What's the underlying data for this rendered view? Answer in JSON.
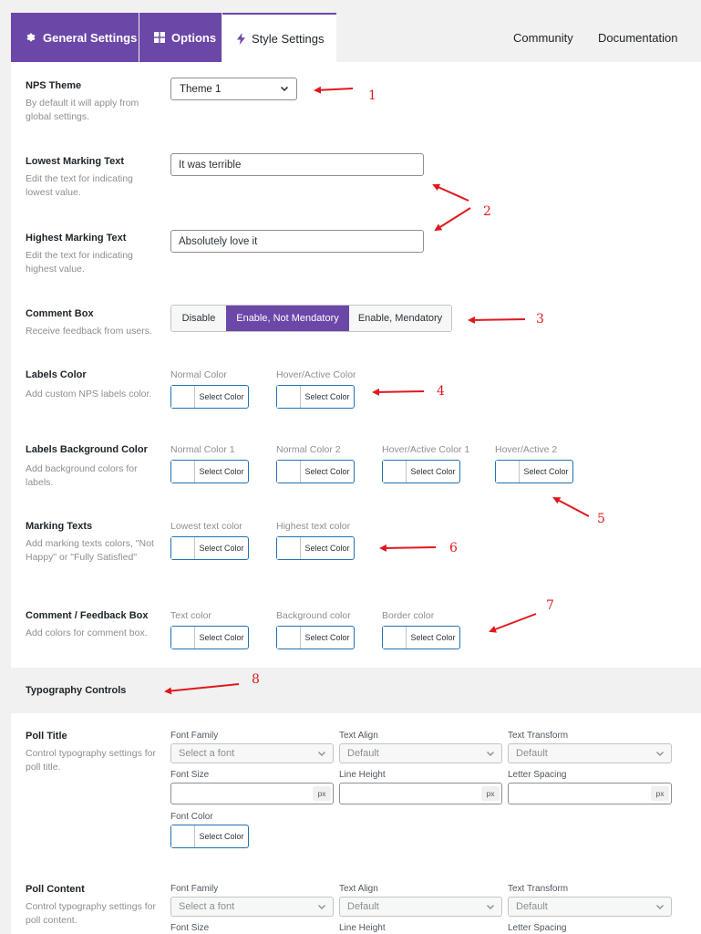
{
  "tabs": [
    {
      "label": "General Settings",
      "icon": "gear-icon"
    },
    {
      "label": "Options",
      "icon": "grid-icon"
    },
    {
      "label": "Style Settings",
      "icon": "bolt-icon"
    }
  ],
  "top_links": {
    "community": "Community",
    "documentation": "Documentation"
  },
  "nps_theme": {
    "label": "NPS Theme",
    "desc": "By default it will apply from global settings.",
    "value": "Theme 1"
  },
  "lowest": {
    "label": "Lowest Marking Text",
    "desc": "Edit the text for indicating lowest value.",
    "value": "It was terrible"
  },
  "highest": {
    "label": "Highest Marking Text",
    "desc": "Edit the text for indicating highest value.",
    "value": "Absolutely love it"
  },
  "comment_box": {
    "label": "Comment Box",
    "desc": "Receive feedback from users.",
    "options": [
      "Disable",
      "Enable, Not Mendatory",
      "Enable, Mendatory"
    ],
    "selected": "Enable, Not Mendatory"
  },
  "select_color": "Select Color",
  "labels_color": {
    "label": "Labels Color",
    "desc": "Add custom NPS labels color.",
    "sub": [
      "Normal Color",
      "Hover/Active Color"
    ]
  },
  "labels_bg": {
    "label": "Labels Background Color",
    "desc": "Add background colors for labels.",
    "sub": [
      "Normal Color 1",
      "Normal Color 2",
      "Hover/Active Color 1",
      "Hover/Active 2"
    ]
  },
  "marking_texts": {
    "label": "Marking Texts",
    "desc": "Add marking texts colors, \"Not Happy\" or \"Fully Satisfied\"",
    "sub": [
      "Lowest text color",
      "Highest text color"
    ]
  },
  "comment_feedback": {
    "label": "Comment / Feedback Box",
    "desc": "Add colors for comment box.",
    "sub": [
      "Text color",
      "Background color",
      "Border color"
    ]
  },
  "typography": {
    "title": "Typography Controls"
  },
  "typo_fields": {
    "font_family": "Font Family",
    "text_align": "Text Align",
    "text_transform": "Text Transform",
    "font_size": "Font Size",
    "line_height": "Line Height",
    "letter_spacing": "Letter Spacing",
    "font_color": "Font Color",
    "font_placeholder": "Select a font",
    "default": "Default",
    "unit": "px"
  },
  "poll_title": {
    "label": "Poll Title",
    "desc": "Control typography settings for poll title."
  },
  "poll_content": {
    "label": "Poll Content",
    "desc": "Control typography settings for poll content."
  },
  "annotations": [
    "1",
    "2",
    "3",
    "4",
    "5",
    "6",
    "7",
    "8"
  ],
  "colors": {
    "accent": "#6b47a8",
    "arrow": "#e0181e",
    "focus_border": "#2271b1"
  }
}
